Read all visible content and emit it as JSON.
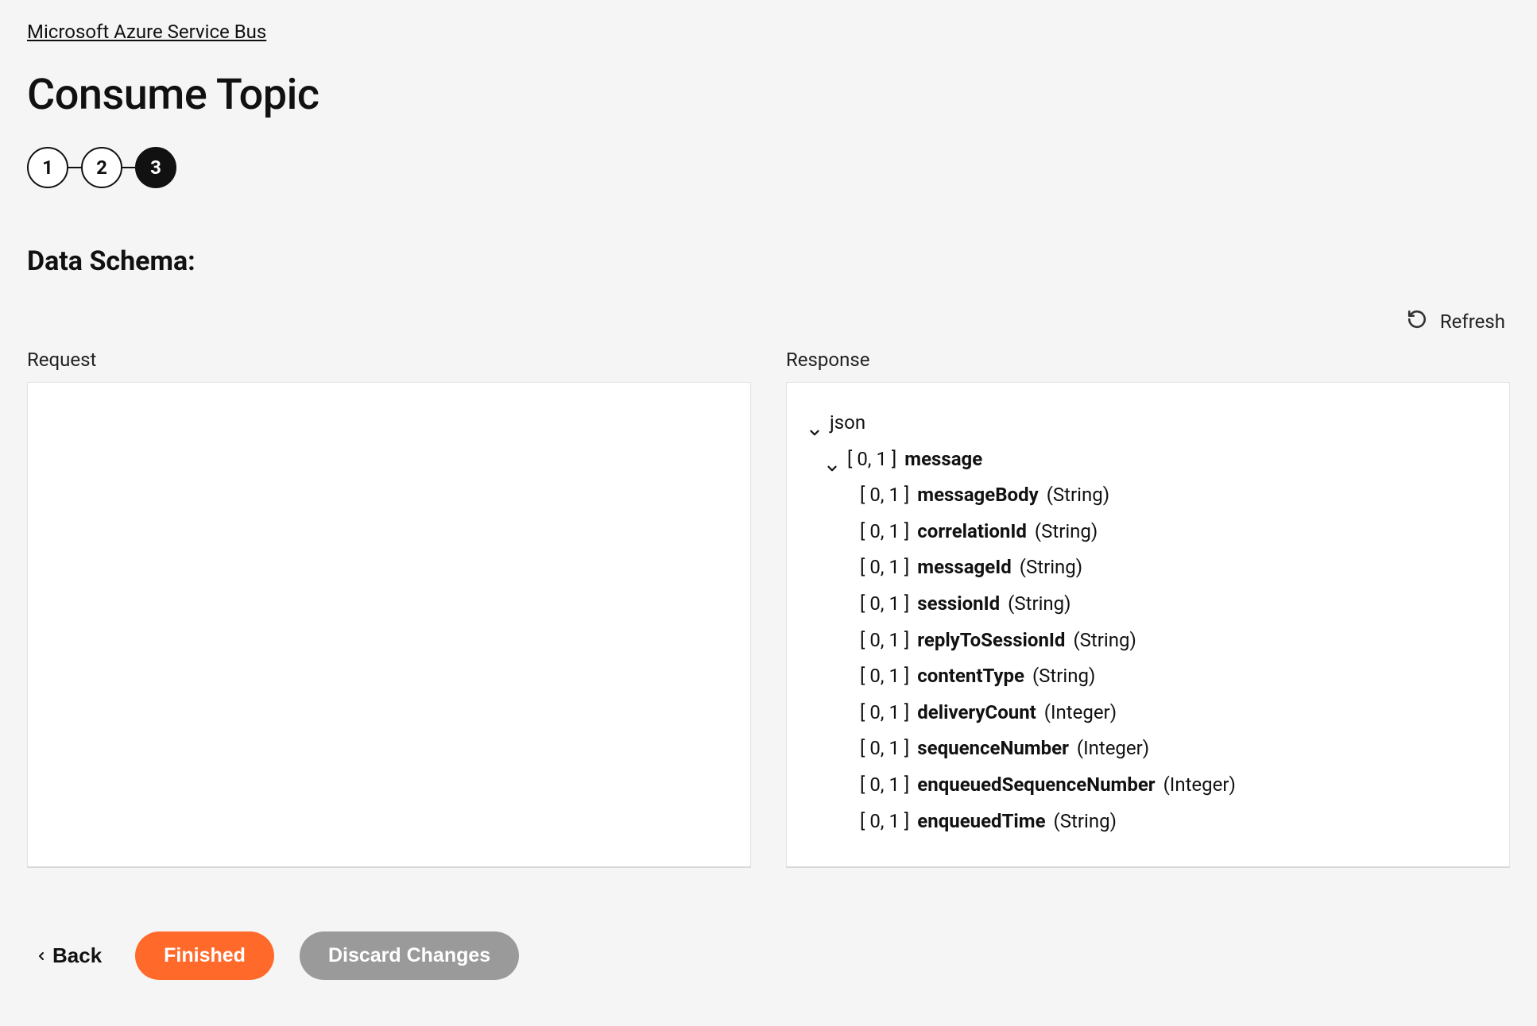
{
  "breadcrumb": "Microsoft Azure Service Bus",
  "title": "Consume Topic",
  "stepper": {
    "steps": [
      "1",
      "2",
      "3"
    ],
    "activeIndex": 2
  },
  "sectionHeading": "Data Schema:",
  "refreshLabel": "Refresh",
  "panels": {
    "request": {
      "label": "Request"
    },
    "response": {
      "label": "Response",
      "tree": {
        "root": "json",
        "message": {
          "cardinality": "[ 0, 1 ]",
          "name": "message"
        },
        "fields": [
          {
            "cardinality": "[ 0, 1 ]",
            "name": "messageBody",
            "type": "(String)"
          },
          {
            "cardinality": "[ 0, 1 ]",
            "name": "correlationId",
            "type": "(String)"
          },
          {
            "cardinality": "[ 0, 1 ]",
            "name": "messageId",
            "type": "(String)"
          },
          {
            "cardinality": "[ 0, 1 ]",
            "name": "sessionId",
            "type": "(String)"
          },
          {
            "cardinality": "[ 0, 1 ]",
            "name": "replyToSessionId",
            "type": "(String)"
          },
          {
            "cardinality": "[ 0, 1 ]",
            "name": "contentType",
            "type": "(String)"
          },
          {
            "cardinality": "[ 0, 1 ]",
            "name": "deliveryCount",
            "type": "(Integer)"
          },
          {
            "cardinality": "[ 0, 1 ]",
            "name": "sequenceNumber",
            "type": "(Integer)"
          },
          {
            "cardinality": "[ 0, 1 ]",
            "name": "enqueuedSequenceNumber",
            "type": "(Integer)"
          },
          {
            "cardinality": "[ 0, 1 ]",
            "name": "enqueuedTime",
            "type": "(String)"
          }
        ]
      }
    }
  },
  "footer": {
    "back": "Back",
    "finished": "Finished",
    "discard": "Discard Changes"
  }
}
